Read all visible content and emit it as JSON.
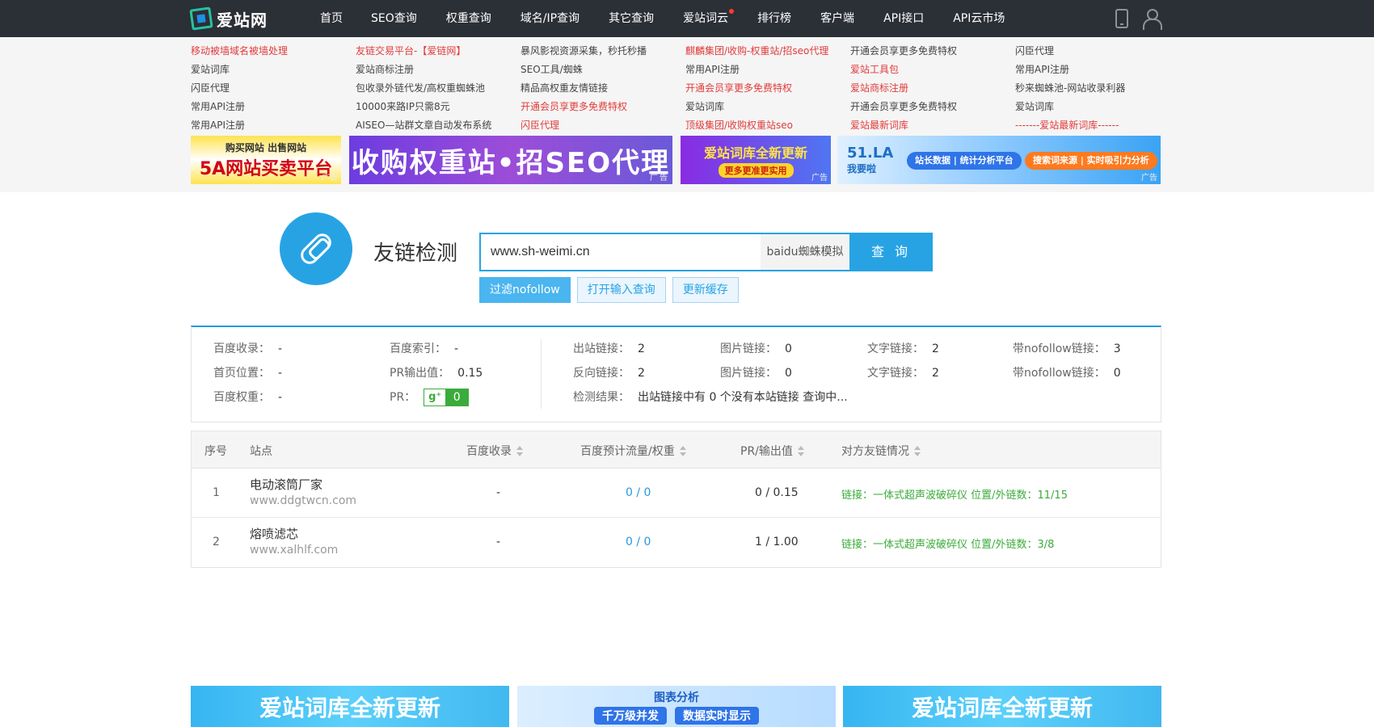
{
  "header": {
    "logo_text": "爱站网",
    "nav": [
      "首页",
      "SEO查询",
      "权重查询",
      "域名/IP查询",
      "其它查询",
      "爱站词云",
      "排行榜",
      "客户端",
      "API接口",
      "API云市场"
    ]
  },
  "ad_links": {
    "columns": [
      [
        {
          "t": "移动被墙域名被墙处理",
          "c": "red"
        },
        {
          "t": "爱站词库",
          "c": "gray"
        },
        {
          "t": "闪臣代理",
          "c": "gray"
        },
        {
          "t": "常用API注册",
          "c": "gray"
        },
        {
          "t": "常用API注册",
          "c": "gray"
        }
      ],
      [
        {
          "t": "友链交易平台-【爱链网】",
          "c": "red"
        },
        {
          "t": "爱站商标注册",
          "c": "gray"
        },
        {
          "t": "包收录外链代发/高权重蜘蛛池",
          "c": "gray"
        },
        {
          "t": "10000来路IP只需8元",
          "c": "gray"
        },
        {
          "t": "AISEO—站群文章自动发布系统",
          "c": "gray"
        }
      ],
      [
        {
          "t": "暴风影视资源采集，秒托秒播",
          "c": "gray"
        },
        {
          "t": "SEO工具/蜘蛛",
          "c": "gray"
        },
        {
          "t": "精品高权重友情链接",
          "c": "gray"
        },
        {
          "t": "开通会员享更多免费特权",
          "c": "red"
        },
        {
          "t": "闪臣代理",
          "c": "red"
        }
      ],
      [
        {
          "t": "麒麟集团/收购-权重站/招seo代理",
          "c": "red"
        },
        {
          "t": "常用API注册",
          "c": "gray"
        },
        {
          "t": "开通会员享更多免费特权",
          "c": "red"
        },
        {
          "t": "爱站词库",
          "c": "gray"
        },
        {
          "t": "顶级集团/收购权重站seo",
          "c": "red"
        }
      ],
      [
        {
          "t": "开通会员享更多免费特权",
          "c": "gray"
        },
        {
          "t": "爱站工具包",
          "c": "red"
        },
        {
          "t": "爱站商标注册",
          "c": "red"
        },
        {
          "t": "开通会员享更多免费特权",
          "c": "gray"
        },
        {
          "t": "爱站最新词库",
          "c": "red"
        }
      ],
      [
        {
          "t": "闪臣代理",
          "c": "gray"
        },
        {
          "t": "常用API注册",
          "c": "gray"
        },
        {
          "t": "秒来蜘蛛池-网站收录利器",
          "c": "gray"
        },
        {
          "t": "爱站词库",
          "c": "gray"
        },
        {
          "t": "-------爱站最新词库------",
          "c": "red"
        }
      ]
    ],
    "banners": {
      "b1_line1": "购买网站 出售网站",
      "b1_line2": "5A网站买卖平台",
      "b2": "收购权重站•招SEO代理",
      "b3_line1": "爱站词库全新更新",
      "b3_line2": "更多更准更实用",
      "b4_brand": "51.LA",
      "b4_sub": "我要啦",
      "b4_p1": "站长数据 | 统计分析平台",
      "b4_p2": "搜索词来源 | 实时吸引力分析",
      "tag": "广告"
    }
  },
  "tool": {
    "title": "友链检测",
    "url": "www.sh-weimi.cn",
    "engine": "baidu蜘蛛模拟",
    "search_btn": "查 询",
    "options": [
      "过滤nofollow",
      "打开输入查询",
      "更新缓存"
    ]
  },
  "stats": {
    "left": [
      [
        {
          "l": "百度收录：",
          "v": "-"
        },
        {
          "l": "百度索引：",
          "v": "-"
        }
      ],
      [
        {
          "l": "首页位置：",
          "v": "-"
        },
        {
          "l": "PR输出值：",
          "v": "0.15"
        }
      ],
      [
        {
          "l": "百度权重：",
          "v": "-"
        },
        {
          "l": "PR：",
          "v": ""
        }
      ]
    ],
    "pr_value": "0",
    "right": [
      [
        {
          "l": "出站链接：",
          "v": "2"
        },
        {
          "l": "图片链接：",
          "v": "0"
        },
        {
          "l": "文字链接：",
          "v": "2"
        },
        {
          "l": "带nofollow链接：",
          "v": "3"
        }
      ],
      [
        {
          "l": "反向链接：",
          "v": "2"
        },
        {
          "l": "图片链接：",
          "v": "0"
        },
        {
          "l": "文字链接：",
          "v": "2"
        },
        {
          "l": "带nofollow链接：",
          "v": "0"
        }
      ]
    ],
    "result_label": "检测结果：",
    "result_text": "出站链接中有 0 个没有本站链接 查询中..."
  },
  "table": {
    "headers": [
      "序号",
      "站点",
      "百度收录",
      "百度预计流量/权重",
      "PR/输出值",
      "对方友链情况"
    ],
    "rows": [
      {
        "idx": "1",
        "name": "电动滚筒厂家",
        "domain": "www.ddgtwcn.com",
        "bl": "-",
        "flow": "0 / 0",
        "pr": "0 / 0.15",
        "link": "链接：一体式超声波破碎仪  位置/外链数：11/15"
      },
      {
        "idx": "2",
        "name": "熔喷滤芯",
        "domain": "www.xalhlf.com",
        "bl": "-",
        "flow": "0 / 0",
        "pr": "1 / 1.00",
        "link": "链接：一体式超声波破碎仪  位置/外链数：3/8"
      }
    ]
  },
  "bottom_banners": {
    "bb1": "爱站词库全新更新",
    "bb2_title": "图表分析",
    "bb2_a": "千万级并发",
    "bb2_b": "数据实时显示",
    "bb3": "爱站词库全新更新"
  }
}
